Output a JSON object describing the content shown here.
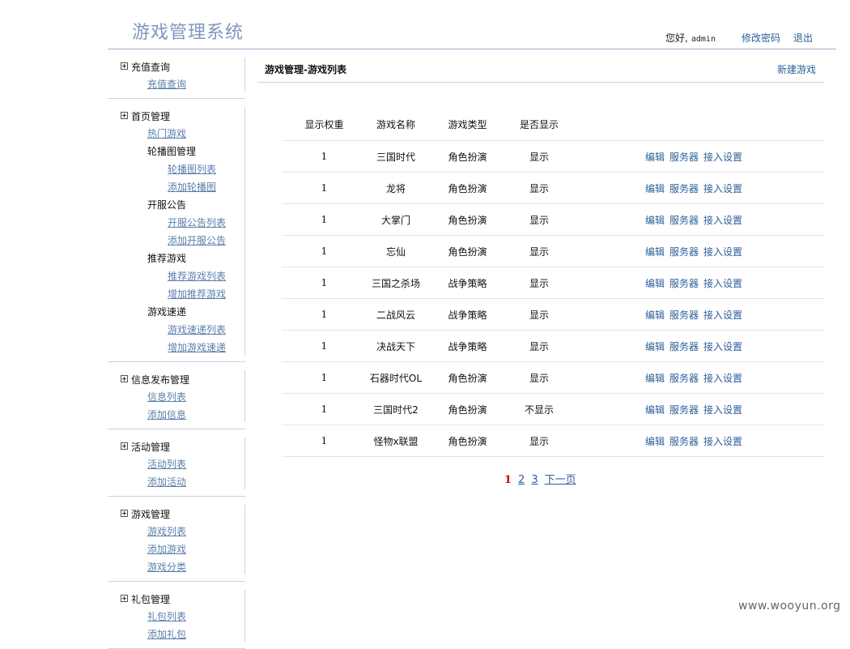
{
  "header": {
    "title": "游戏管理系统",
    "greeting": "您好,",
    "username": "admin",
    "change_password": "修改密码",
    "logout": "退出"
  },
  "sidebar": {
    "groups": [
      {
        "title": "充值查询",
        "items": [
          {
            "label": "充值查询",
            "type": "link"
          }
        ]
      },
      {
        "title": "首页管理",
        "items": [
          {
            "label": "热门游戏",
            "type": "link"
          },
          {
            "label": "轮播图管理",
            "type": "sub"
          },
          {
            "label": "轮播图列表",
            "type": "link2"
          },
          {
            "label": "添加轮播图",
            "type": "link2"
          },
          {
            "label": "开服公告",
            "type": "sub"
          },
          {
            "label": "开服公告列表",
            "type": "link2"
          },
          {
            "label": "添加开服公告",
            "type": "link2"
          },
          {
            "label": "推荐游戏",
            "type": "sub"
          },
          {
            "label": "推荐游戏列表",
            "type": "link2"
          },
          {
            "label": "增加推荐游戏",
            "type": "link2"
          },
          {
            "label": "游戏速递",
            "type": "sub"
          },
          {
            "label": "游戏速递列表",
            "type": "link2"
          },
          {
            "label": "增加游戏速递",
            "type": "link2"
          }
        ]
      },
      {
        "title": "信息发布管理",
        "items": [
          {
            "label": "信息列表",
            "type": "link"
          },
          {
            "label": "添加信息",
            "type": "link"
          }
        ]
      },
      {
        "title": "活动管理",
        "items": [
          {
            "label": "活动列表",
            "type": "link"
          },
          {
            "label": "添加活动",
            "type": "link"
          }
        ]
      },
      {
        "title": "游戏管理",
        "items": [
          {
            "label": "游戏列表",
            "type": "link"
          },
          {
            "label": "添加游戏",
            "type": "link"
          },
          {
            "label": "游戏分类",
            "type": "link"
          }
        ]
      },
      {
        "title": "礼包管理",
        "items": [
          {
            "label": "礼包列表",
            "type": "link"
          },
          {
            "label": "添加礼包",
            "type": "link"
          }
        ]
      }
    ]
  },
  "main": {
    "title": "游戏管理-游戏列表",
    "new_game": "新建游戏",
    "columns": [
      "显示权重",
      "游戏名称",
      "游戏类型",
      "是否显示"
    ],
    "actions": [
      "编辑",
      "服务器",
      "接入设置"
    ],
    "rows": [
      {
        "weight": "1",
        "name": "三国时代",
        "type": "角色扮演",
        "show": "显示"
      },
      {
        "weight": "1",
        "name": "龙将",
        "type": "角色扮演",
        "show": "显示"
      },
      {
        "weight": "1",
        "name": "大掌门",
        "type": "角色扮演",
        "show": "显示"
      },
      {
        "weight": "1",
        "name": "忘仙",
        "type": "角色扮演",
        "show": "显示"
      },
      {
        "weight": "1",
        "name": "三国之杀场",
        "type": "战争策略",
        "show": "显示"
      },
      {
        "weight": "1",
        "name": "二战风云",
        "type": "战争策略",
        "show": "显示"
      },
      {
        "weight": "1",
        "name": "决战天下",
        "type": "战争策略",
        "show": "显示"
      },
      {
        "weight": "1",
        "name": "石器时代OL",
        "type": "角色扮演",
        "show": "显示"
      },
      {
        "weight": "1",
        "name": "三国时代2",
        "type": "角色扮演",
        "show": "不显示"
      },
      {
        "weight": "1",
        "name": "怪物x联盟",
        "type": "角色扮演",
        "show": "显示"
      }
    ],
    "pager": {
      "current": "1",
      "pages": [
        "2",
        "3"
      ],
      "next": "下一页"
    }
  },
  "watermark": "www.wooyun.org"
}
